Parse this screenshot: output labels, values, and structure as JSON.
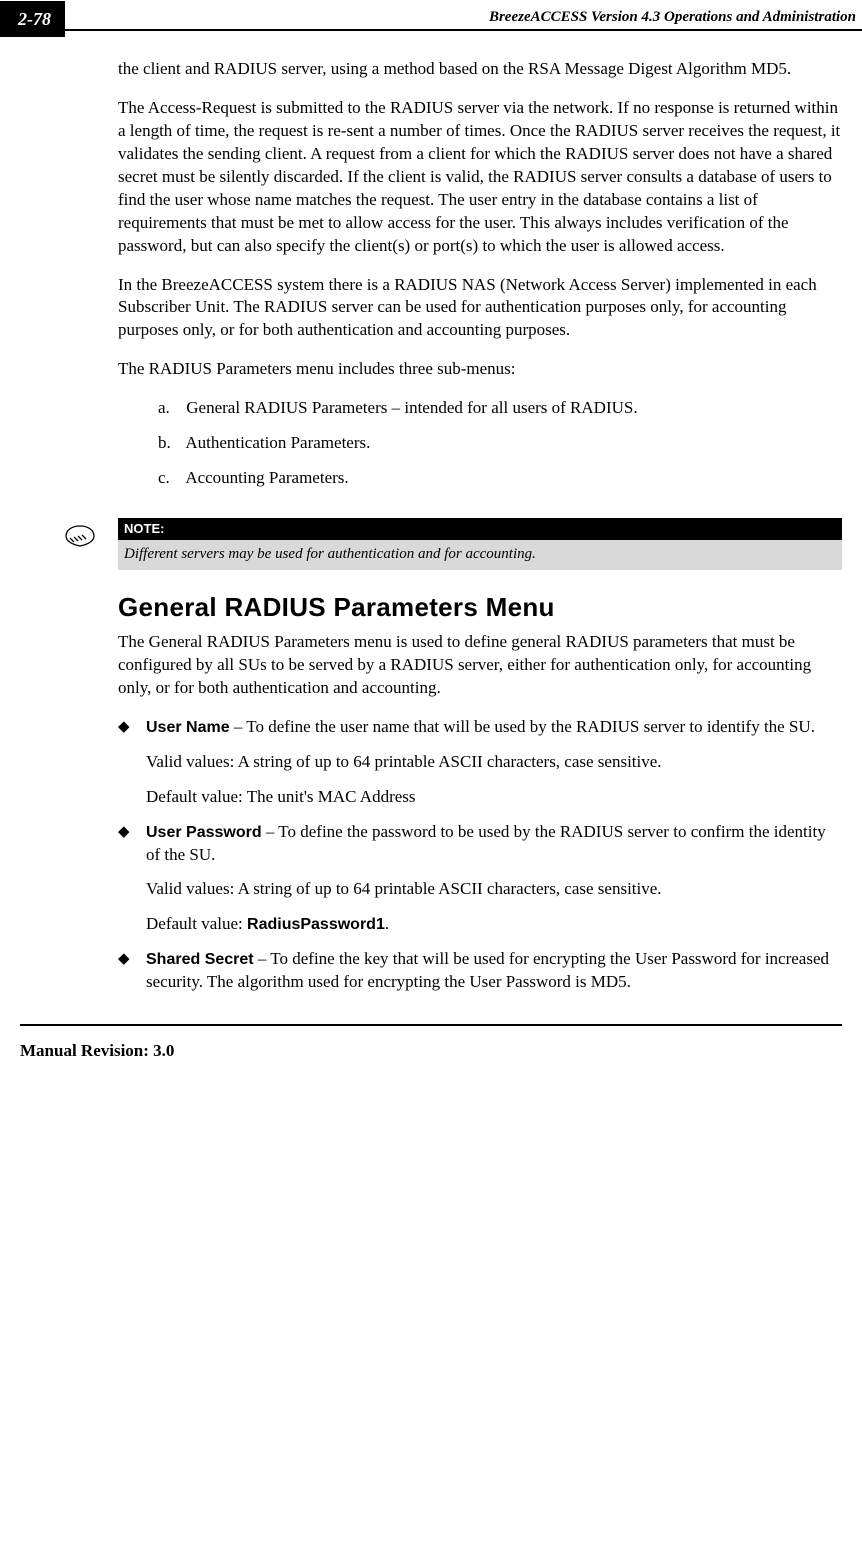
{
  "header": {
    "page_number": "2-78",
    "header_title": "BreezeACCESS Version 4.3 Operations and Administration"
  },
  "paragraphs": {
    "p1": "the client and RADIUS server, using a method based on the RSA Message Digest Algorithm MD5.",
    "p2": "The Access-Request is submitted to the RADIUS server via the network. If no response is returned within a length of time, the request is re-sent a number of times. Once the RADIUS server receives the request, it validates the sending client. A request from a client for which the RADIUS server does not have a shared secret must be silently discarded. If the client is valid, the RADIUS server consults a database of users to find the user whose name matches the request. The user entry in the database contains a list of requirements that must be met to allow access for the user. This always includes verification of the password, but can also specify the client(s) or port(s) to which the user is allowed access.",
    "p3": "In the BreezeACCESS system there is a RADIUS NAS (Network Access Server) implemented in each Subscriber Unit. The RADIUS server can be used for authentication purposes only, for accounting purposes only, or for both authentication and accounting purposes.",
    "p4": "The RADIUS Parameters menu includes three sub-menus:"
  },
  "submenus": {
    "a_label": "a.",
    "a_text": "General RADIUS Parameters – intended for all users of RADIUS.",
    "b_label": "b.",
    "b_text": "Authentication Parameters.",
    "c_label": "c.",
    "c_text": " Accounting Parameters."
  },
  "note": {
    "head": "NOTE:",
    "body": "Different servers may be used for authentication and for accounting."
  },
  "section": {
    "title": "General RADIUS Parameters Menu",
    "intro": "The General RADIUS Parameters menu is used to define general RADIUS parameters that must be configured by all SUs to be served by a RADIUS server, either for authentication only, for accounting only, or for both authentication and accounting."
  },
  "bullets": {
    "user_name": {
      "label": "User Name",
      "def": " – To define the user name that will be used by the RADIUS server to identify the SU.",
      "valid": "Valid values: A string of up to 64 printable ASCII characters, case sensitive.",
      "default": "Default value: The unit's MAC Address"
    },
    "user_password": {
      "label": "User Password",
      "def": " – To define the password to be used by the RADIUS server to confirm the identity of the SU.",
      "valid": "Valid values: A string of up to 64 printable ASCII characters, case sensitive.",
      "default_pre": "Default value: ",
      "default_val": "RadiusPassword1",
      "default_post": "."
    },
    "shared_secret": {
      "label": "Shared Secret",
      "def": " – To define the key that will be used for encrypting the User Password for increased security. The algorithm used for encrypting the User Password is MD5."
    }
  },
  "footer": {
    "revision": "Manual Revision: 3.0"
  }
}
